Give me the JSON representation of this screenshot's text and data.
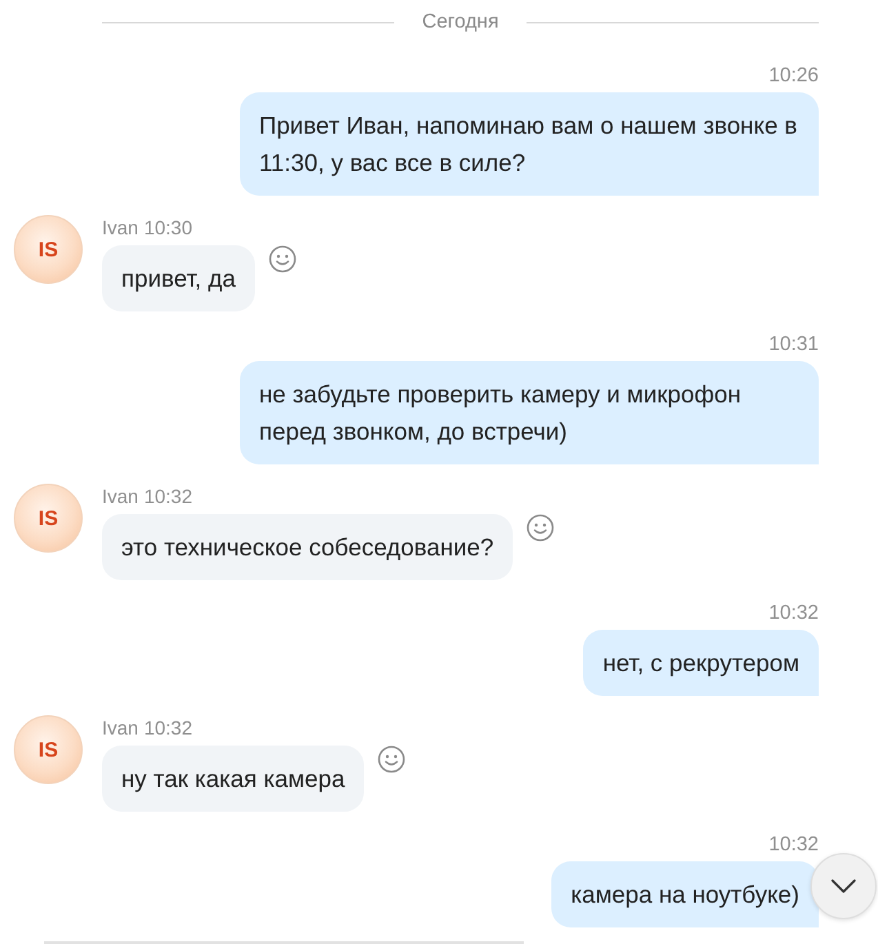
{
  "date_separator": {
    "label": "Сегодня"
  },
  "messages": [
    {
      "kind": "outgoing",
      "time": "10:26",
      "text": "Привет Иван, напоминаю вам о нашем звонке в 11:30, у вас все в силе?"
    },
    {
      "kind": "incoming",
      "avatar_initials": "IS",
      "sender": "Ivan",
      "time": "10:30",
      "text": "привет, да"
    },
    {
      "kind": "outgoing",
      "time": "10:31",
      "text": "не забудьте проверить камеру и микрофон перед звонком, до встречи)"
    },
    {
      "kind": "incoming",
      "avatar_initials": "IS",
      "sender": "Ivan",
      "time": "10:32",
      "text": "это техническое собеседование?"
    },
    {
      "kind": "outgoing",
      "time": "10:32",
      "text": "нет, с рекрутером"
    },
    {
      "kind": "incoming",
      "avatar_initials": "IS",
      "sender": "Ivan",
      "time": "10:32",
      "text": "ну так какая камера"
    },
    {
      "kind": "outgoing",
      "time": "10:32",
      "text": "камера на ноутбуке)"
    }
  ]
}
